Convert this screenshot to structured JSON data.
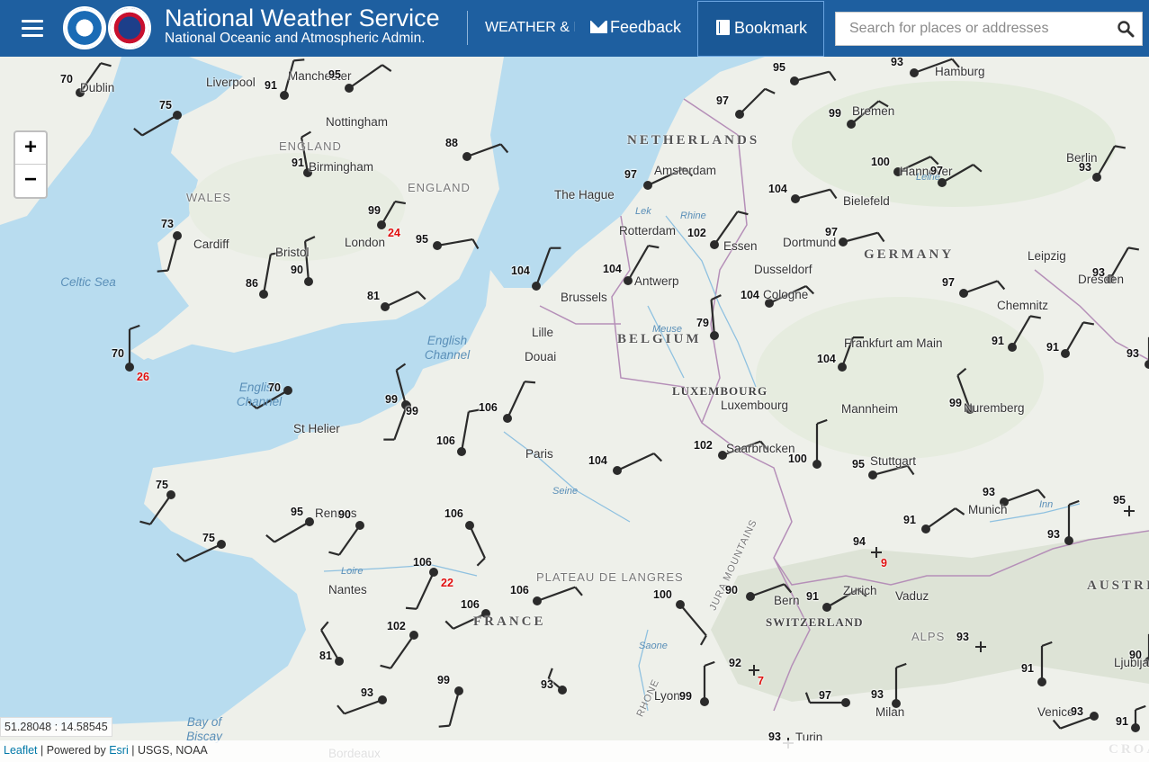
{
  "header": {
    "title": "National Weather Service",
    "subtitle": "National Oceanic and Atmospheric Admin.",
    "nav_weather": "WEATHER & I",
    "nav_feedback": "Feedback",
    "nav_bookmark": "Bookmark",
    "search_placeholder": "Search for places or addresses"
  },
  "map": {
    "zoom_in": "+",
    "zoom_out": "−",
    "coordinates": "51.28048 : 14.58545",
    "attribution": {
      "leaflet": "Leaflet",
      "powered_by": " | Powered by ",
      "esri": "Esri",
      "sources": " | USGS, NOAA"
    },
    "places": [
      {
        "name": "Dublin",
        "kind": "city"
      },
      {
        "name": "Liverpool",
        "kind": "city"
      },
      {
        "name": "Manchester",
        "kind": "city"
      },
      {
        "name": "Nottingham",
        "kind": "city"
      },
      {
        "name": "ENGLAND",
        "kind": "region"
      },
      {
        "name": "Birmingham",
        "kind": "city"
      },
      {
        "name": "ENGLAND",
        "kind": "region"
      },
      {
        "name": "WALES",
        "kind": "region"
      },
      {
        "name": "Cardiff",
        "kind": "city"
      },
      {
        "name": "Bristol",
        "kind": "city"
      },
      {
        "name": "London",
        "kind": "city"
      },
      {
        "name": "Celtic Sea",
        "kind": "sea"
      },
      {
        "name": "English Channel",
        "kind": "sea"
      },
      {
        "name": "English Channel",
        "kind": "sea"
      },
      {
        "name": "St Helier",
        "kind": "city"
      },
      {
        "name": "NETHERLANDS",
        "kind": "country"
      },
      {
        "name": "Amsterdam",
        "kind": "city"
      },
      {
        "name": "The Hague",
        "kind": "city"
      },
      {
        "name": "Rotterdam",
        "kind": "city"
      },
      {
        "name": "Essen",
        "kind": "city"
      },
      {
        "name": "Dortmund",
        "kind": "city"
      },
      {
        "name": "Dusseldorf",
        "kind": "city"
      },
      {
        "name": "Bremen",
        "kind": "city"
      },
      {
        "name": "Hamburg",
        "kind": "city"
      },
      {
        "name": "Hannover",
        "kind": "city"
      },
      {
        "name": "Bielefeld",
        "kind": "city"
      },
      {
        "name": "Berlin",
        "kind": "city"
      },
      {
        "name": "GERMANY",
        "kind": "country"
      },
      {
        "name": "Leipzig",
        "kind": "city"
      },
      {
        "name": "Dresden",
        "kind": "city"
      },
      {
        "name": "Chemnitz",
        "kind": "city"
      },
      {
        "name": "Antwerp",
        "kind": "city"
      },
      {
        "name": "Brussels",
        "kind": "city"
      },
      {
        "name": "Cologne",
        "kind": "city"
      },
      {
        "name": "BELGIUM",
        "kind": "country"
      },
      {
        "name": "Lille",
        "kind": "city"
      },
      {
        "name": "Douai",
        "kind": "city"
      },
      {
        "name": "LUXEMBOURG",
        "kind": "small"
      },
      {
        "name": "Luxembourg",
        "kind": "city"
      },
      {
        "name": "Frankfurt am Main",
        "kind": "city"
      },
      {
        "name": "Mannheim",
        "kind": "city"
      },
      {
        "name": "Nuremberg",
        "kind": "city"
      },
      {
        "name": "Saarbrucken",
        "kind": "city"
      },
      {
        "name": "Stuttgart",
        "kind": "city"
      },
      {
        "name": "Munich",
        "kind": "city"
      },
      {
        "name": "Paris",
        "kind": "city"
      },
      {
        "name": "Rennes",
        "kind": "city"
      },
      {
        "name": "Nantes",
        "kind": "city"
      },
      {
        "name": "PLATEAU DE LANGRES",
        "kind": "region"
      },
      {
        "name": "FRANCE",
        "kind": "country"
      },
      {
        "name": "Bern",
        "kind": "city"
      },
      {
        "name": "Zurich",
        "kind": "city"
      },
      {
        "name": "Vaduz",
        "kind": "city"
      },
      {
        "name": "SWITZERLAND",
        "kind": "small"
      },
      {
        "name": "AUSTRIA",
        "kind": "country"
      },
      {
        "name": "ALPS",
        "kind": "region"
      },
      {
        "name": "JURA MOUNTAINS",
        "kind": "region"
      },
      {
        "name": "Lyon",
        "kind": "city"
      },
      {
        "name": "Milan",
        "kind": "city"
      },
      {
        "name": "Turin",
        "kind": "city"
      },
      {
        "name": "Venice",
        "kind": "city"
      },
      {
        "name": "Ljubljana",
        "kind": "city"
      },
      {
        "name": "Bay of Biscay",
        "kind": "sea"
      },
      {
        "name": "Bordeaux",
        "kind": "city"
      },
      {
        "name": "CROATIA",
        "kind": "country"
      },
      {
        "name": "Leine",
        "kind": "river"
      },
      {
        "name": "Rhine",
        "kind": "river"
      },
      {
        "name": "Lek",
        "kind": "river"
      },
      {
        "name": "Meuse",
        "kind": "river"
      },
      {
        "name": "Seine",
        "kind": "river"
      },
      {
        "name": "Loire",
        "kind": "river"
      },
      {
        "name": "Saone",
        "kind": "river"
      },
      {
        "name": "Inn",
        "kind": "river"
      },
      {
        "name": "RHONE",
        "kind": "region"
      }
    ],
    "stations": [
      {
        "value": "70"
      },
      {
        "value": "75"
      },
      {
        "value": "91"
      },
      {
        "value": "95"
      },
      {
        "value": "88"
      },
      {
        "value": "91"
      },
      {
        "value": "73"
      },
      {
        "value": "99",
        "gust": "24"
      },
      {
        "value": "95"
      },
      {
        "value": "86"
      },
      {
        "value": "90"
      },
      {
        "value": "81"
      },
      {
        "value": "70",
        "gust": "26"
      },
      {
        "value": "70"
      },
      {
        "value": "99"
      },
      {
        "value": "95"
      },
      {
        "value": "97"
      },
      {
        "value": "99"
      },
      {
        "value": "93"
      },
      {
        "value": "97"
      },
      {
        "value": "100"
      },
      {
        "value": "97"
      },
      {
        "value": "104"
      },
      {
        "value": "93"
      },
      {
        "value": "102"
      },
      {
        "value": "97"
      },
      {
        "value": "104"
      },
      {
        "value": "104"
      },
      {
        "value": "104"
      },
      {
        "value": "93"
      },
      {
        "value": "97"
      },
      {
        "value": "79"
      },
      {
        "value": "91"
      },
      {
        "value": "91"
      },
      {
        "value": "93"
      },
      {
        "value": "104"
      },
      {
        "value": "106"
      },
      {
        "value": "99"
      },
      {
        "value": "106"
      },
      {
        "value": "104"
      },
      {
        "value": "99"
      },
      {
        "value": "102"
      },
      {
        "value": "100"
      },
      {
        "value": "95"
      },
      {
        "value": "93"
      },
      {
        "value": "91"
      },
      {
        "value": "93"
      },
      {
        "value": "95"
      },
      {
        "value": "75"
      },
      {
        "value": "95"
      },
      {
        "value": "90"
      },
      {
        "value": "75"
      },
      {
        "value": "106"
      },
      {
        "value": "106",
        "gust": "22"
      },
      {
        "value": "106"
      },
      {
        "value": "106"
      },
      {
        "value": "100"
      },
      {
        "value": "90"
      },
      {
        "value": "91"
      },
      {
        "value": "94",
        "gust": "9"
      },
      {
        "value": "93"
      },
      {
        "value": "102"
      },
      {
        "value": "81"
      },
      {
        "value": "99"
      },
      {
        "value": "93"
      },
      {
        "value": "93"
      },
      {
        "value": "99"
      },
      {
        "value": "92",
        "gust": "7"
      },
      {
        "value": "97"
      },
      {
        "value": "93"
      },
      {
        "value": "91"
      },
      {
        "value": "93"
      },
      {
        "value": "90"
      },
      {
        "value": "91"
      },
      {
        "value": "93"
      }
    ]
  }
}
